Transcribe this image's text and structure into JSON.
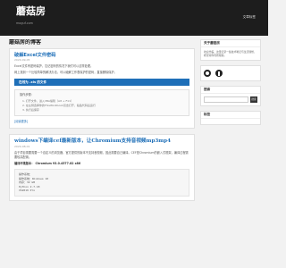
{
  "topbar": {
    "brand": "蘑菇房",
    "brand_sub": "moguf.com",
    "nav": "文章标签"
  },
  "main": {
    "section_title": "蘑菇房的博客",
    "post1": {
      "title": "破解Excel文件密码",
      "date": "2020-09-05",
      "p1": "Excel文件有密码保护，忘记密码的情况下我们可以这样处理。",
      "p2": "网上找到一个比较简单的解决办法，可以破解工作表保护的密码，直接删除保护。",
      "ad": "在线为 .xls 的文件",
      "toc_heading": "操作步骤：",
      "toc_items": [
        "1. 打开文件，进入VBA编辑（Alt + F11）",
        "2. 在左侧选择你的ThisWorkbook双击打开，粘贴代码后运行",
        "3. 执行后保存"
      ],
      "read_more": "[阅读更多]"
    },
    "post2": {
      "title": "windows下编译cef最新版本，让Chromium支持音视频mp3mp4",
      "date": "2020-08-01",
      "p1": "由于项目需要需要一个自定义的浏览器，官方提供的版本不支持音视频，因此需要自己编译。CEF是Chromium的嵌入式框架，编译过程需要较高配置。",
      "env_label": "编译环境版本：",
      "env_value": "Chromium 93.0.4577.82 x86",
      "code_lines": [
        "操作系统：",
        "操作系统：Windows 10",
        "内存：32 GB",
        "Python 2.7.18",
        "VS2019 Pro"
      ]
    }
  },
  "sidebar": {
    "about_title": "关于蘑菇房",
    "about_text": "欢迎光临，这里记录一些技术笔记与生活随想，希望对你有所帮助。",
    "social_title": "",
    "search_title": "搜索",
    "search_placeholder": "",
    "search_button": "搜索",
    "tags_title": "标签",
    "tags_text": ""
  },
  "colors": {
    "topbar": "#1d1d1d",
    "accent": "#1e6fb8",
    "background": "#f2f2f2"
  }
}
